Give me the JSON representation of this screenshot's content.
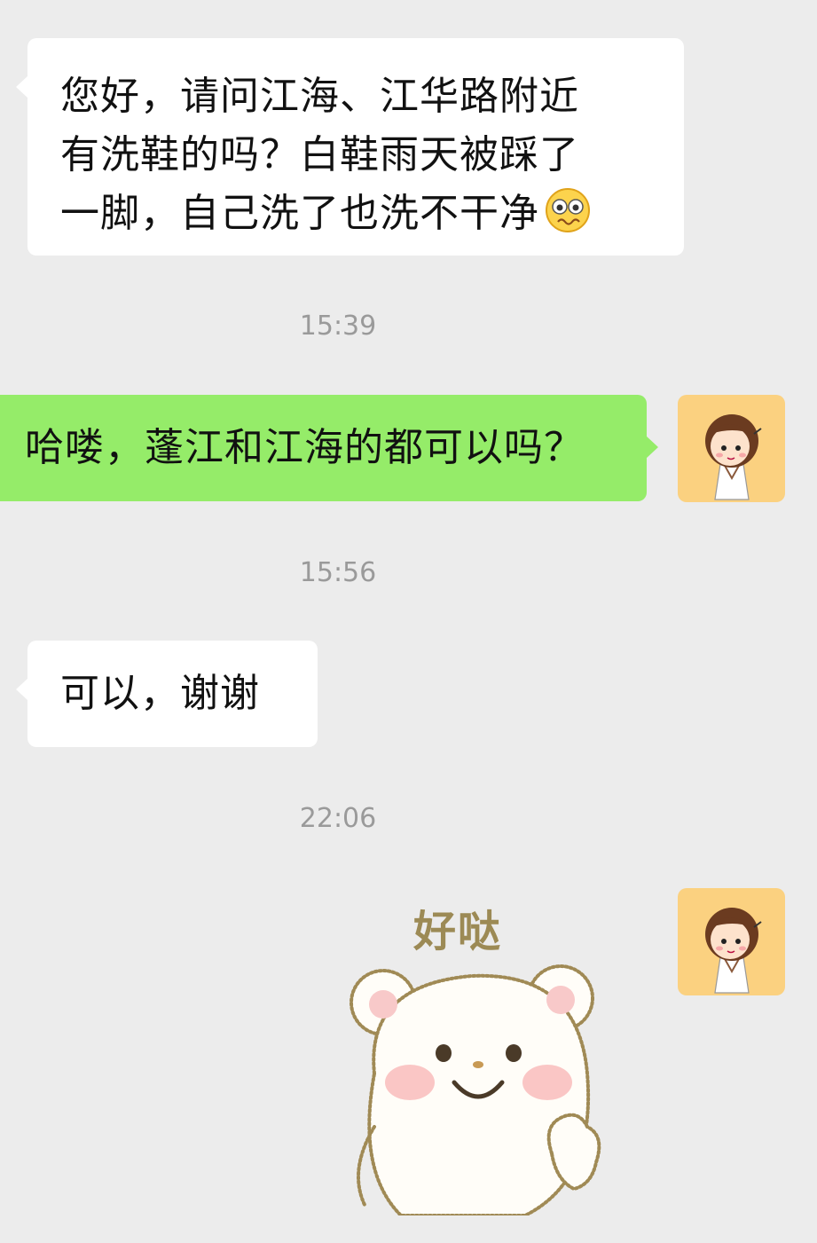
{
  "messages": [
    {
      "side": "left",
      "lines": [
        "您好，请问江海、江华路附近",
        "有洗鞋的吗？白鞋雨天被踩了",
        "一脚，自己洗了也洗不干净"
      ],
      "emoji": "worried-face-icon"
    },
    {
      "time": "15:39"
    },
    {
      "side": "right",
      "text": "哈喽，蓬江和江海的都可以吗？"
    },
    {
      "time": "15:56"
    },
    {
      "side": "left",
      "text": "可以，谢谢"
    },
    {
      "time": "22:06"
    },
    {
      "side": "right",
      "sticker": {
        "caption": "好哒",
        "icon": "bear-ok-sticker"
      }
    }
  ],
  "colors": {
    "background": "#ececec",
    "bubble_left": "#ffffff",
    "bubble_right": "#95ec69",
    "avatar_bg": "#fbd180",
    "timestamp": "#9a9a9a"
  }
}
